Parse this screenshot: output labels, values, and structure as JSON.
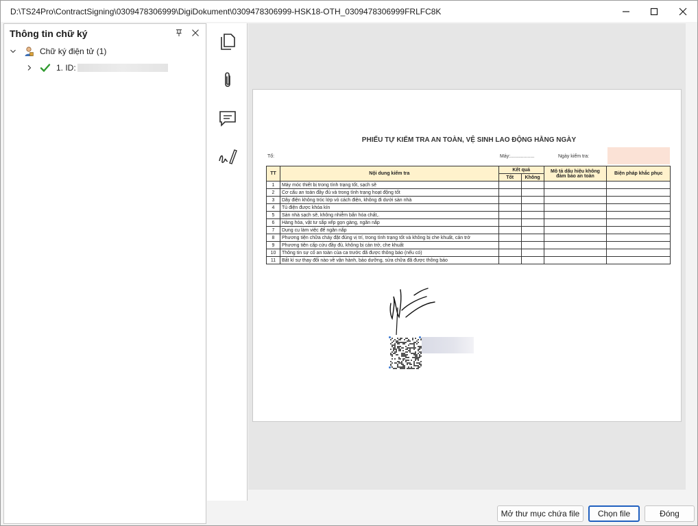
{
  "window": {
    "title": "D:\\TS24Pro\\ContractSigning\\0309478306999\\DigiDokument\\0309478306999-HSK18-OTH_0309478306999FRLFC8K",
    "controls": [
      "minimize-icon",
      "maximize-icon",
      "close-icon"
    ]
  },
  "signature_panel": {
    "title": "Thông tin chữ ký",
    "group_label": "Chữ ký điện tử (1)",
    "items": [
      {
        "label": "1. ID:",
        "status": "valid"
      }
    ]
  },
  "toolbar": {
    "tools": [
      "pages-icon",
      "attachment-icon",
      "comment-icon",
      "signature-icon"
    ]
  },
  "document": {
    "title": "PHIẾU TỰ KIỂM TRA AN TOÀN, VỆ SINH LAO ĐỘNG HẰNG NGÀY",
    "to_label": "Tổ:",
    "machine_label": "Máy:..................",
    "date_label": "Ngày kiểm tra:",
    "headers": {
      "tt": "TT",
      "content": "Nội dung kiểm tra",
      "result": "Kết quả",
      "ok": "Tốt",
      "not_ok": "Không",
      "description": "Mô tả dấu hiệu không đảm bảo an toàn",
      "remedy": "Biện pháp khắc phục"
    },
    "rows": [
      {
        "tt": "1",
        "content": "Máy móc thiết bị trong tình trạng tốt, sạch sẽ"
      },
      {
        "tt": "2",
        "content": "Cơ cấu an toàn đầy đủ và trong tình trạng hoạt động tốt"
      },
      {
        "tt": "3",
        "content": "Dây điện không tróc lớp vỏ cách điện, không đi dưới sàn nhà"
      },
      {
        "tt": "4",
        "content": "Tủ điện được khóa kín"
      },
      {
        "tt": "5",
        "content": "Sàn nhà sạch sẽ, không nhiễm bẩn hóa chất,."
      },
      {
        "tt": "6",
        "content": "Hàng hóa, vật tư sắp xếp gọn gàng, ngăn nắp"
      },
      {
        "tt": "7",
        "content": "Dụng cụ làm việc để ngăn nắp"
      },
      {
        "tt": "8",
        "content": "Phương tiện chữa cháy đặt đúng vị trí, trong tình trạng tốt và không bị che khuất, cản trở"
      },
      {
        "tt": "9",
        "content": "Phương tiện cấp cứu đầy đủ, không bị cản trở, che khuất"
      },
      {
        "tt": "10",
        "content": "Thông tin sự cố an toàn của ca trước đã được thông báo (nếu có)"
      },
      {
        "tt": "11",
        "content": "Bất kì sự thay đổi nào về vận hành, bảo dưỡng, sửa chữa đã được thông báo"
      }
    ]
  },
  "footer": {
    "open_folder": "Mở thư mục chứa file",
    "choose_file": "Chọn file",
    "close": "Đóng"
  }
}
